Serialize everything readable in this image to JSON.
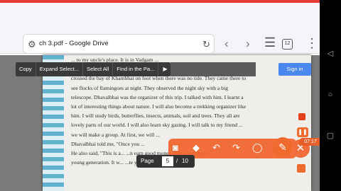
{
  "browser": {
    "back_glyph": "‹",
    "url_text": "ch 3.pdf - Google Drive",
    "reload_glyph": "↻",
    "nav_back": "‹",
    "nav_forward": "›",
    "tabs_count": "12",
    "menu_glyph": "⋮"
  },
  "context_menu": {
    "items": [
      "Copy",
      "Expand Select...",
      "Select All",
      "Find in the Pa..."
    ],
    "more_glyph": "▶"
  },
  "signin_label": "Sign in",
  "document": {
    "lines": [
      "... to my uncle's place. It is in Vadgam ...",
      "... ys and girls from Baroda came there. ...",
      "crossed the bay of Khambhat on foot when there was no tide. They came there to",
      "see flocks of flamingoes at night. They observed the night sky with a big",
      "telescope. Dhavalbhai was the organizer of this trip. I talked with him. I learnt a",
      "lot of interesting things about nature. I will also become a trekking organizer like",
      "him. I will study birds, butterflies, insects, animals, soil and trees. They all are",
      "lovely parts of our world. I will also learn sky gazing. I will talk to my friend ...",
      "we will make a group. At first, we will ...",
      "Dhavalbhai told me, \"Once you ...",
      "He also said, \"This is a... ...n earn good money. It is a service to",
      "young generation. It w... ...te your life thrilling.\""
    ]
  },
  "pager": {
    "label": "Page",
    "current": "5",
    "separator": "/",
    "total": "10"
  },
  "recorder": {
    "time": "07:17"
  },
  "colors": {
    "accent": "#f06a2e",
    "signin": "#4a87ee",
    "top_strip": "#e53935"
  }
}
